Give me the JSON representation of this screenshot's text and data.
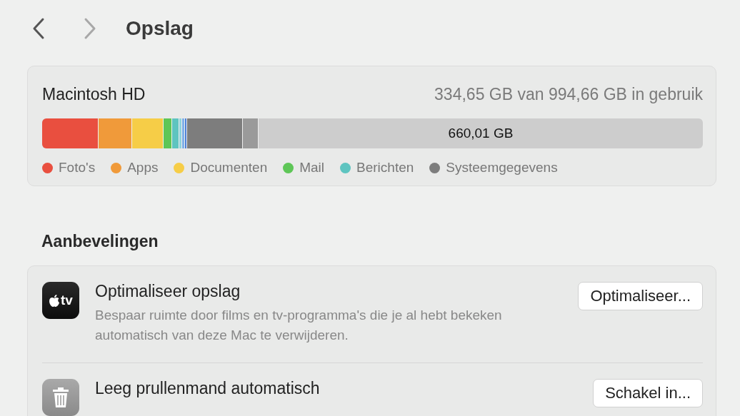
{
  "toolbar": {
    "title": "Opslag",
    "back_disabled": false,
    "forward_disabled": true
  },
  "storage": {
    "disk": "Macintosh HD",
    "usage": "334,65 GB van 994,66 GB in gebruik",
    "free_label": "660,01 GB",
    "segments": [
      {
        "color": "#e94f3f"
      },
      {
        "color": "#f09a3a"
      },
      {
        "color": "#f6cd47"
      },
      {
        "color": "#5ec657"
      },
      {
        "color": "#5ec4c0"
      },
      {
        "color": "#8fd2dd"
      },
      {
        "color": "#7fb0e8"
      },
      {
        "color": "#4a7fd6"
      },
      {
        "color": "#7d7d7d"
      },
      {
        "color": "#9a9a9a"
      }
    ],
    "legend": [
      {
        "label": "Foto's",
        "color": "#e94f3f"
      },
      {
        "label": "Apps",
        "color": "#f09a3a"
      },
      {
        "label": "Documenten",
        "color": "#f6cd47"
      },
      {
        "label": "Mail",
        "color": "#5ec657"
      },
      {
        "label": "Berichten",
        "color": "#5ec4c0"
      },
      {
        "label": "Systeemgegevens",
        "color": "#7d7d7d"
      }
    ]
  },
  "recommendations": {
    "heading": "Aanbevelingen",
    "items": [
      {
        "kind": "tv",
        "icon_text": "tv",
        "title": "Optimaliseer opslag",
        "description": "Bespaar ruimte door films en tv-programma's die je al hebt bekeken automatisch van deze Mac te verwijderen.",
        "button": "Optimaliseer..."
      },
      {
        "kind": "trash",
        "title": "Leeg prullenmand automatisch",
        "button": "Schakel in..."
      }
    ]
  }
}
